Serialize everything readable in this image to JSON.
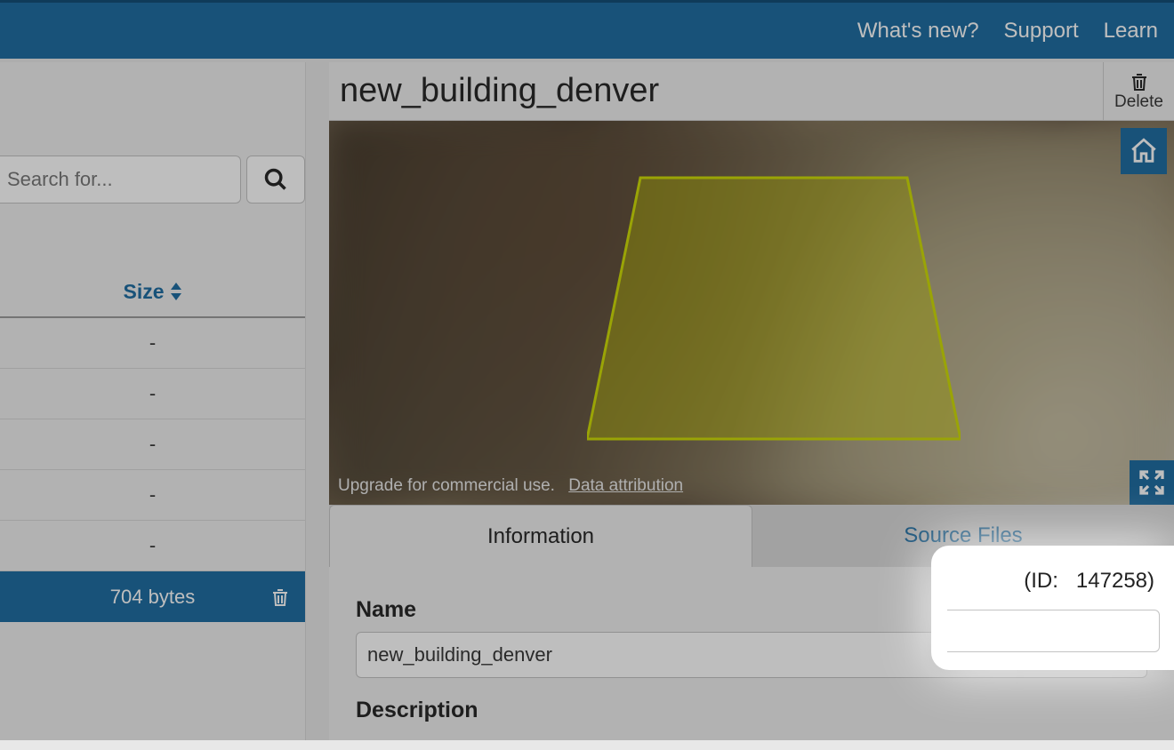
{
  "topbar": {
    "whatsnew": "What's new?",
    "support": "Support",
    "learn": "Learn"
  },
  "search": {
    "placeholder": "Search for..."
  },
  "table": {
    "size_header": "Size",
    "rows": [
      {
        "size": "-"
      },
      {
        "size": "-"
      },
      {
        "size": "-"
      },
      {
        "size": "-"
      },
      {
        "size": "-"
      },
      {
        "size": "704 bytes",
        "selected": true
      }
    ]
  },
  "detail": {
    "title": "new_building_denver",
    "delete_label": "Delete",
    "attribution_text": "Upgrade for commercial use.",
    "attribution_link": "Data attribution",
    "tabs": {
      "info": "Information",
      "source": "Source Files"
    },
    "form": {
      "name_label": "Name",
      "name_value": "new_building_denver",
      "description_label": "Description"
    },
    "id_label": "(ID:",
    "id_value": "147258)"
  }
}
